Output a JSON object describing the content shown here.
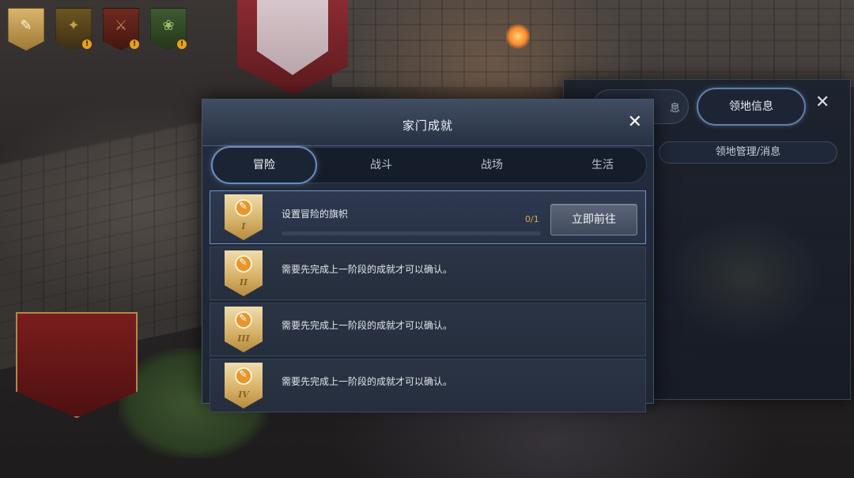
{
  "top_icons": [
    {
      "name": "family-banner-icon",
      "glyph": "✎",
      "has_alert": false
    },
    {
      "name": "combat-banner-icon",
      "glyph": "✦",
      "has_alert": true,
      "alert_text": "!"
    },
    {
      "name": "battlefield-banner-icon",
      "glyph": "⚔",
      "has_alert": true,
      "alert_text": "!"
    },
    {
      "name": "life-banner-icon",
      "glyph": "❀",
      "has_alert": true,
      "alert_text": "!"
    }
  ],
  "background_panel": {
    "partial_tab_label": "息",
    "active_tab_label": "领地信息",
    "close_glyph": "✕",
    "subbar_label": "领地管理/消息"
  },
  "dialog": {
    "title": "家门成就",
    "close_glyph": "✕",
    "tabs": [
      {
        "label": "冒险",
        "active": true
      },
      {
        "label": "战斗",
        "active": false
      },
      {
        "label": "战场",
        "active": false
      },
      {
        "label": "生活",
        "active": false
      }
    ],
    "achievements": [
      {
        "tier": "I",
        "title": "设置冒险的旗帜",
        "progress_text": "0/1",
        "progress": 0.0,
        "button_label": "立即前往",
        "active": true
      },
      {
        "tier": "II",
        "message": "需要先完成上一阶段的成就才可以确认。",
        "active": false
      },
      {
        "tier": "III",
        "message": "需要先完成上一阶段的成就才可以确认。",
        "active": false
      },
      {
        "tier": "IV",
        "message": "需要先完成上一阶段的成就才可以确认。",
        "active": false
      }
    ]
  },
  "colors": {
    "accent_blue": "#6a8cb8",
    "progress_gold": "#c79a3d",
    "alert_orange": "#e5a21b"
  }
}
